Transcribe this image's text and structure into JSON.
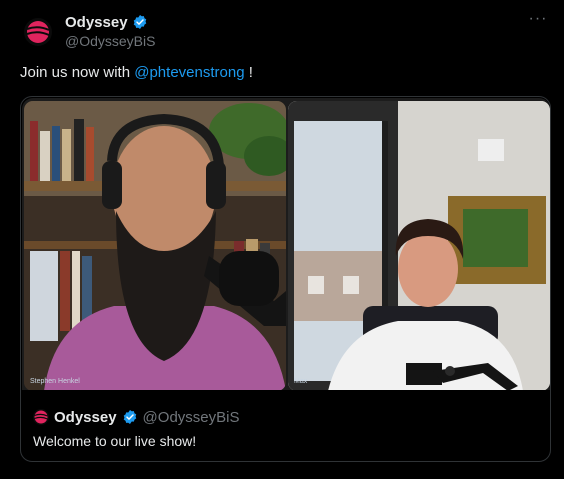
{
  "author": {
    "display_name": "Odyssey",
    "handle": "@OdysseyBiS",
    "avatar_icon": "odyssey-logo-icon",
    "verified_icon": "verified-badge-icon",
    "more_icon": "more-options-icon"
  },
  "tweet": {
    "text_before": "Join us now with ",
    "mention": "@phtevenstrong",
    "text_after": " !"
  },
  "video": {
    "left_participant_label": "Stephen Henkel",
    "right_participant_label": "Max"
  },
  "quoted_tweet": {
    "display_name": "Odyssey",
    "handle": "@OdysseyBiS",
    "text": "Welcome to our live show!"
  },
  "colors": {
    "background": "#000000",
    "text": "#e7e9ea",
    "secondary": "#71767b",
    "link": "#1d9bf0",
    "brand_pink": "#e0245e",
    "border": "#2f3336"
  }
}
